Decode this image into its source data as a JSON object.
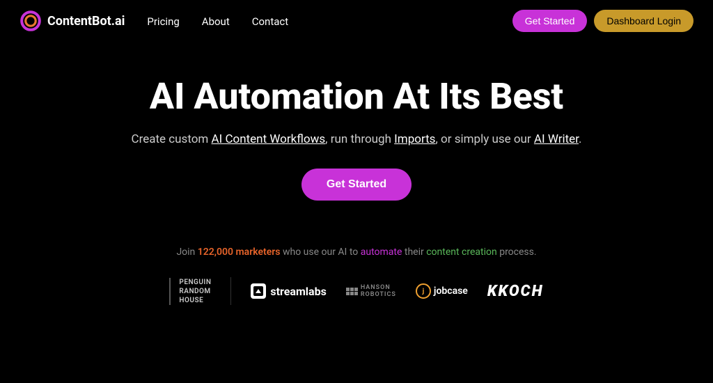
{
  "nav": {
    "logo_text": "ContentBot.ai",
    "links": [
      {
        "label": "Pricing",
        "name": "pricing"
      },
      {
        "label": "About",
        "name": "about"
      },
      {
        "label": "Contact",
        "name": "contact"
      }
    ],
    "btn_get_started": "Get Started",
    "btn_dashboard_login": "Dashboard Login"
  },
  "hero": {
    "heading": "AI Automation At Its Best",
    "subtitle_plain_1": "Create custom ",
    "subtitle_link_1": "AI Content Workflows",
    "subtitle_plain_2": ", run through ",
    "subtitle_link_2": "Imports",
    "subtitle_plain_3": ", or simply use our ",
    "subtitle_link_3": "AI Writer",
    "subtitle_plain_4": ".",
    "btn_get_started": "Get Started"
  },
  "social_proof": {
    "text_1": "Join ",
    "highlight_1": "122,000 marketers",
    "text_2": " who use our AI to ",
    "highlight_2": "automate",
    "text_3": " their ",
    "highlight_3": "content creation",
    "text_4": " process."
  },
  "logos": [
    {
      "name": "penguin-random-house",
      "label": "Penguin Random House"
    },
    {
      "name": "streamlabs",
      "label": "streamlabs"
    },
    {
      "name": "hanson-robotics",
      "label": "HANSON ROBOTICS"
    },
    {
      "name": "jobcase",
      "label": "jobcase"
    },
    {
      "name": "koch",
      "label": "KKOCH"
    }
  ]
}
